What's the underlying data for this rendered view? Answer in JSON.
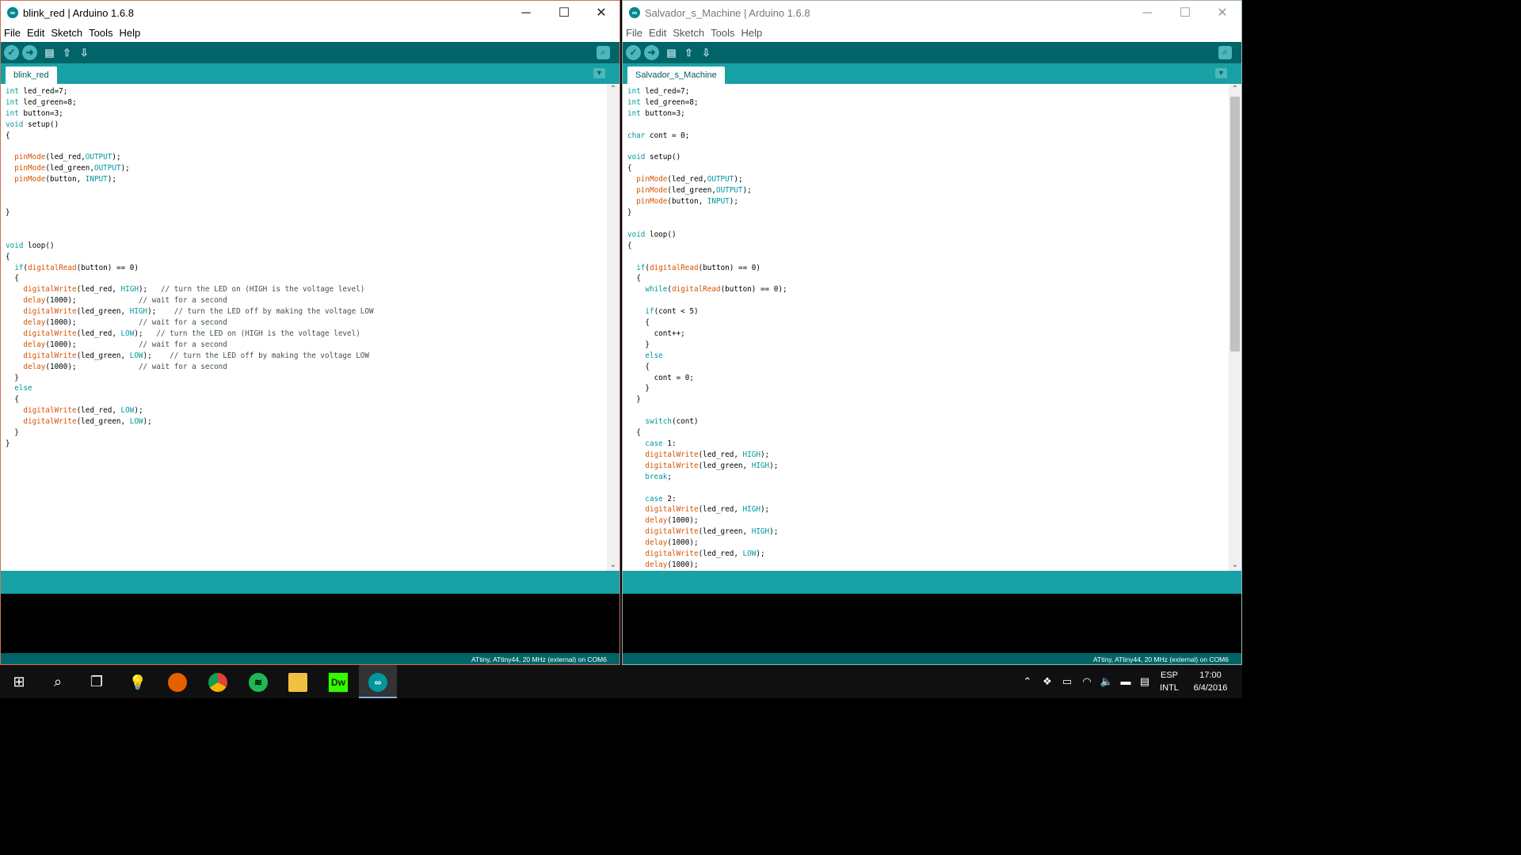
{
  "left_window": {
    "title": "blink_red | Arduino 1.6.8",
    "menu": [
      "File",
      "Edit",
      "Sketch",
      "Tools",
      "Help"
    ],
    "tab": "blink_red",
    "board_status": "ATtiny, ATtiny44, 20 MHz (external) on COM6",
    "code_lines": [
      "int led_red=7;",
      "int led_green=8;",
      "int button=3;",
      "void setup()",
      "{",
      "",
      "  pinMode(led_red,OUTPUT);",
      "  pinMode(led_green,OUTPUT);",
      "  pinMode(button, INPUT);",
      "",
      "",
      "}",
      "",
      "",
      "void loop()",
      "{",
      "  if(digitalRead(button) == 0)",
      "  {",
      "    digitalWrite(led_red, HIGH);   // turn the LED on (HIGH is the voltage level)",
      "    delay(1000);              // wait for a second",
      "    digitalWrite(led_green, HIGH);    // turn the LED off by making the voltage LOW",
      "    delay(1000);              // wait for a second",
      "    digitalWrite(led_red, LOW);   // turn the LED on (HIGH is the voltage level)",
      "    delay(1000);              // wait for a second",
      "    digitalWrite(led_green, LOW);    // turn the LED off by making the voltage LOW",
      "    delay(1000);              // wait for a second",
      "  }",
      "  else",
      "  {",
      "    digitalWrite(led_red, LOW);",
      "    digitalWrite(led_green, LOW);",
      "  }",
      "}"
    ]
  },
  "right_window": {
    "title": "Salvador_s_Machine | Arduino 1.6.8",
    "menu": [
      "File",
      "Edit",
      "Sketch",
      "Tools",
      "Help"
    ],
    "tab": "Salvador_s_Machine",
    "board_status": "ATtiny, ATtiny44, 20 MHz (external) on COM6",
    "code_lines": [
      "int led_red=7;",
      "int led_green=8;",
      "int button=3;",
      "",
      "char cont = 0;",
      "",
      "void setup()",
      "{",
      "  pinMode(led_red,OUTPUT);",
      "  pinMode(led_green,OUTPUT);",
      "  pinMode(button, INPUT);",
      "}",
      "",
      "void loop()",
      "{",
      "",
      "  if(digitalRead(button) == 0)",
      "  {",
      "    while(digitalRead(button) == 0);",
      "",
      "    if(cont < 5)",
      "    {",
      "      cont++;",
      "    }",
      "    else",
      "    {",
      "      cont = 0;",
      "    }",
      "  }",
      "",
      "    switch(cont)",
      "  {",
      "    case 1:",
      "    digitalWrite(led_red, HIGH);",
      "    digitalWrite(led_green, HIGH);",
      "    break;",
      "",
      "    case 2:",
      "    digitalWrite(led_red, HIGH);",
      "    delay(1000);",
      "    digitalWrite(led_green, HIGH);",
      "    delay(1000);",
      "    digitalWrite(led_red, LOW);",
      "    delay(1000);"
    ]
  },
  "window_controls": [
    "minimize-icon",
    "maximize-icon",
    "close-icon"
  ],
  "toolbar_icons": [
    "verify-icon",
    "upload-icon",
    "new-icon",
    "open-icon",
    "save-icon"
  ],
  "taskbar": {
    "apps": [
      "windows-start-icon",
      "search-icon",
      "task-view-icon",
      "tips-icon",
      "firefox-icon",
      "chrome-icon",
      "spotify-icon",
      "file-explorer-icon",
      "dreamweaver-icon",
      "arduino-icon"
    ],
    "dreamweaver_label": "Dw",
    "language": "ESP",
    "layout": "INTL",
    "time": "17:00",
    "date": "6/4/2016"
  },
  "colors": {
    "toolbar": "#006468",
    "tabbar": "#17a1a5",
    "keyword": "#00979c",
    "function": "#d35400"
  }
}
